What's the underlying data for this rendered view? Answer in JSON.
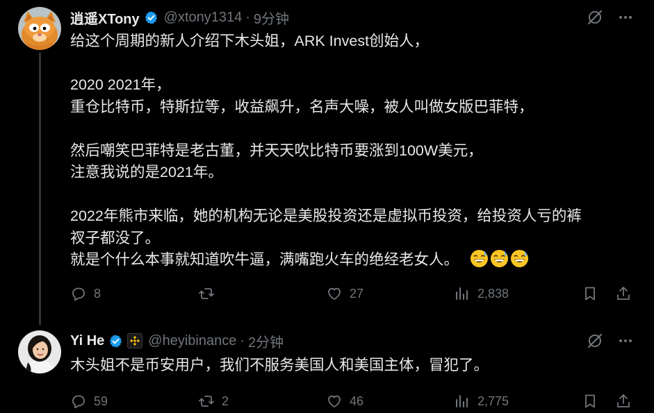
{
  "posts": [
    {
      "author": "逍遥XTony",
      "handle": "@xtony1314",
      "separator": "·",
      "time": "9分钟",
      "lines": [
        "给这个周期的新人介绍下木头姐，ARK Invest创始人，",
        "",
        "2020 2021年，",
        "重仓比特币，特斯拉等，收益飙升，名声大噪，被人叫做女版巴菲特，",
        "",
        "然后嘲笑巴菲特是老古董，并天天吹比特币要涨到100W美元，",
        "注意我说的是2021年。",
        "",
        "2022年熊市来临，她的机构无论是美股投资还是虚拟币投资，给投资人亏的裤",
        "衩子都没了。",
        "就是个什么本事就知道吹牛逼，满嘴跑火车的绝经老女人。"
      ],
      "emojis": [
        "grinning-sweat-emoji",
        "grinning-sweat-emoji",
        "grinning-sweat-emoji"
      ],
      "stats": {
        "replies": "8",
        "reposts": "",
        "likes": "27",
        "views": "2,838"
      }
    },
    {
      "author": "Yi He",
      "handle": "@heyibinance",
      "separator": "·",
      "time": "2分钟",
      "lines": [
        "木头姐不是币安用户，我们不服务美国人和美国主体，冒犯了。"
      ],
      "stats": {
        "replies": "59",
        "reposts": "2",
        "likes": "46",
        "views": "2,775"
      }
    }
  ],
  "colors": {
    "background": "#000000",
    "text": "#e7e9ea",
    "muted": "#71767b",
    "verified": "#1d9bf0",
    "binance_gold": "#f0b90b",
    "thread_line": "#333639"
  },
  "icons": {
    "verified": "verified-badge-icon",
    "grok": "grok-icon",
    "more": "more-dots-icon",
    "reply": "reply-icon",
    "repost": "repost-icon",
    "like": "heart-icon",
    "views": "views-chart-icon",
    "bookmark": "bookmark-icon",
    "share": "share-icon"
  }
}
